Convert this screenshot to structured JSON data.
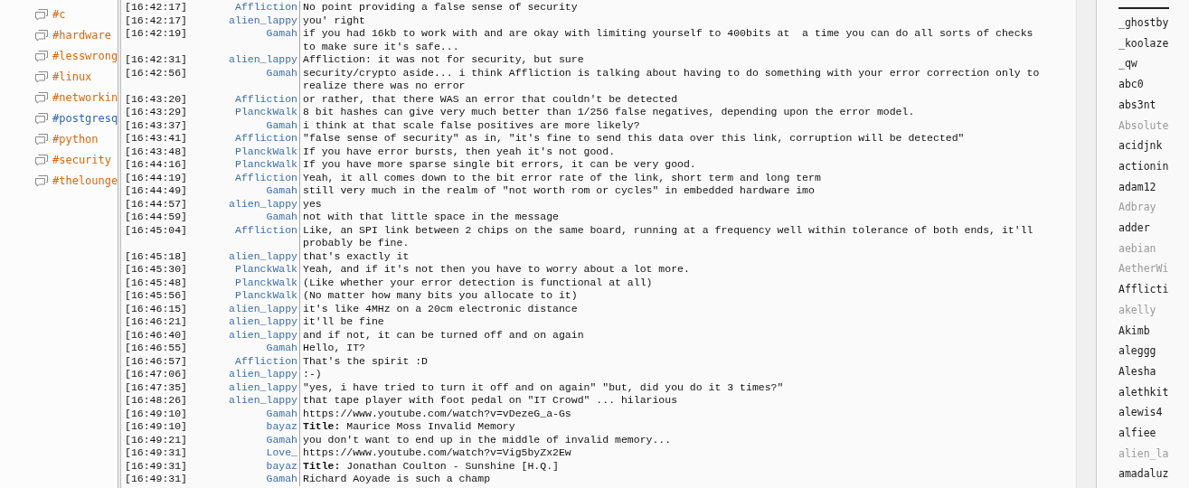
{
  "channels": [
    {
      "name": "#c",
      "color": "#d9680f"
    },
    {
      "name": "#hardware",
      "color": "#d9680f"
    },
    {
      "name": "#lesswrong",
      "color": "#d9680f"
    },
    {
      "name": "#linux",
      "color": "#d9680f"
    },
    {
      "name": "#networkin",
      "color": "#d9680f"
    },
    {
      "name": "#postgresq",
      "color": "#3366b8"
    },
    {
      "name": "#python",
      "color": "#d9680f"
    },
    {
      "name": "#security",
      "color": "#d9680f"
    },
    {
      "name": "#thelounge",
      "color": "#d9680f"
    }
  ],
  "messages": [
    {
      "time": "[16:42:17]",
      "nick": "Affliction",
      "text": "No point providing a false sense of security"
    },
    {
      "time": "[16:42:17]",
      "nick": "alien_lappy",
      "text": "you' right"
    },
    {
      "time": "[16:42:19]",
      "nick": "Gamah",
      "text": "if you had 16kb to work with and are okay with limiting yourself to 400bits at  a time you can do all sorts of checks to make sure it's safe..."
    },
    {
      "time": "[16:42:31]",
      "nick": "alien_lappy",
      "text": "Affliction: it was not for security, but sure"
    },
    {
      "time": "[16:42:56]",
      "nick": "Gamah",
      "text": "security/crypto aside... i think Affliction is talking about having to do something with your error correction only to realize there was no error"
    },
    {
      "time": "[16:43:20]",
      "nick": "Affliction",
      "text": "or rather, that there WAS an error that couldn't be detected"
    },
    {
      "time": "[16:43:29]",
      "nick": "PlanckWalk",
      "text": "8 bit hashes can give very much better than 1/256 false negatives, depending upon the error model."
    },
    {
      "time": "[16:43:37]",
      "nick": "Gamah",
      "text": "i think at that scale false positives are more likely?"
    },
    {
      "time": "[16:43:41]",
      "nick": "Affliction",
      "text": "\"false sense of security\" as in, \"it's fine to send this data over this link, corruption will be detected\""
    },
    {
      "time": "[16:43:48]",
      "nick": "PlanckWalk",
      "text": "If you have error bursts, then yeah it's not good."
    },
    {
      "time": "[16:44:16]",
      "nick": "PlanckWalk",
      "text": "If you have more sparse single bit errors, it can be very good."
    },
    {
      "time": "[16:44:19]",
      "nick": "Affliction",
      "text": "Yeah, it all comes down to the bit error rate of the link, short term and long term"
    },
    {
      "time": "[16:44:49]",
      "nick": "Gamah",
      "text": "still very much in the realm of \"not worth rom or cycles\" in embedded hardware imo"
    },
    {
      "time": "[16:44:57]",
      "nick": "alien_lappy",
      "text": "yes"
    },
    {
      "time": "[16:44:59]",
      "nick": "Gamah",
      "text": "not with that little space in the message"
    },
    {
      "time": "[16:45:04]",
      "nick": "Affliction",
      "text": "Like, an SPI link between 2 chips on the same board, running at a frequency well within tolerance of both ends, it'll probably be fine."
    },
    {
      "time": "[16:45:18]",
      "nick": "alien_lappy",
      "text": "that's exactly it"
    },
    {
      "time": "[16:45:30]",
      "nick": "PlanckWalk",
      "text": "Yeah, and if it's not then you have to worry about a lot more."
    },
    {
      "time": "[16:45:48]",
      "nick": "PlanckWalk",
      "text": "(Like whether your error detection is functional at all)"
    },
    {
      "time": "[16:45:56]",
      "nick": "PlanckWalk",
      "text": "(No matter how many bits you allocate to it)"
    },
    {
      "time": "[16:46:15]",
      "nick": "alien_lappy",
      "text": "it's like 4MHz on a 20cm electronic distance"
    },
    {
      "time": "[16:46:21]",
      "nick": "alien_lappy",
      "text": "it'll be fine"
    },
    {
      "time": "[16:46:40]",
      "nick": "alien_lappy",
      "text": "and if not, it can be turned off and on again"
    },
    {
      "time": "[16:46:55]",
      "nick": "Gamah",
      "text": "Hello, IT?"
    },
    {
      "time": "[16:46:57]",
      "nick": "Affliction",
      "text": "That's the spirit :D"
    },
    {
      "time": "[16:47:06]",
      "nick": "alien_lappy",
      "text": ":-)"
    },
    {
      "time": "[16:47:35]",
      "nick": "alien_lappy",
      "text": "\"yes, i have tried to turn it off and on again\" \"but, did you do it 3 times?\""
    },
    {
      "time": "[16:48:26]",
      "nick": "alien_lappy",
      "text": "that tape player with foot pedal on \"IT Crowd\" ... hilarious"
    },
    {
      "time": "[16:49:10]",
      "nick": "Gamah",
      "text": "https://www.youtube.com/watch?v=vDezeG_a-Gs"
    },
    {
      "time": "[16:49:10]",
      "nick": "bayaz",
      "text": "**Title:** Maurice Moss Invalid Memory"
    },
    {
      "time": "[16:49:21]",
      "nick": "Gamah",
      "text": "you don't want to end up in the middle of invalid memory..."
    },
    {
      "time": "[16:49:31]",
      "nick": "Love_",
      "text": "https://www.youtube.com/watch?v=Vig5byZx2Ew"
    },
    {
      "time": "[16:49:31]",
      "nick": "bayaz",
      "text": "**Title:** Jonathan Coulton - Sunshine [H.Q.]"
    },
    {
      "time": "[16:49:31]",
      "nick": "Gamah",
      "text": "Richard Aoyade is such a champ"
    }
  ],
  "users": [
    {
      "name": "_ghostby",
      "away": false
    },
    {
      "name": "_koolaze",
      "away": false
    },
    {
      "name": "_qw",
      "away": false
    },
    {
      "name": "abc0",
      "away": false
    },
    {
      "name": "abs3nt",
      "away": false
    },
    {
      "name": "Absolute",
      "away": true
    },
    {
      "name": "acidjnk",
      "away": false
    },
    {
      "name": "actionin",
      "away": false
    },
    {
      "name": "adam12",
      "away": false
    },
    {
      "name": "Adbray",
      "away": true
    },
    {
      "name": "adder",
      "away": false
    },
    {
      "name": "aebian",
      "away": true
    },
    {
      "name": "AetherWi",
      "away": true
    },
    {
      "name": "Afflicti",
      "away": false
    },
    {
      "name": "akelly",
      "away": true
    },
    {
      "name": "Akimb",
      "away": false
    },
    {
      "name": "aleggg",
      "away": false
    },
    {
      "name": "Alesha",
      "away": false
    },
    {
      "name": "alethkit",
      "away": false
    },
    {
      "name": "alewis4",
      "away": false
    },
    {
      "name": "alfiee",
      "away": false
    },
    {
      "name": "alien_la",
      "away": true
    },
    {
      "name": "amadaluz",
      "away": false
    }
  ]
}
